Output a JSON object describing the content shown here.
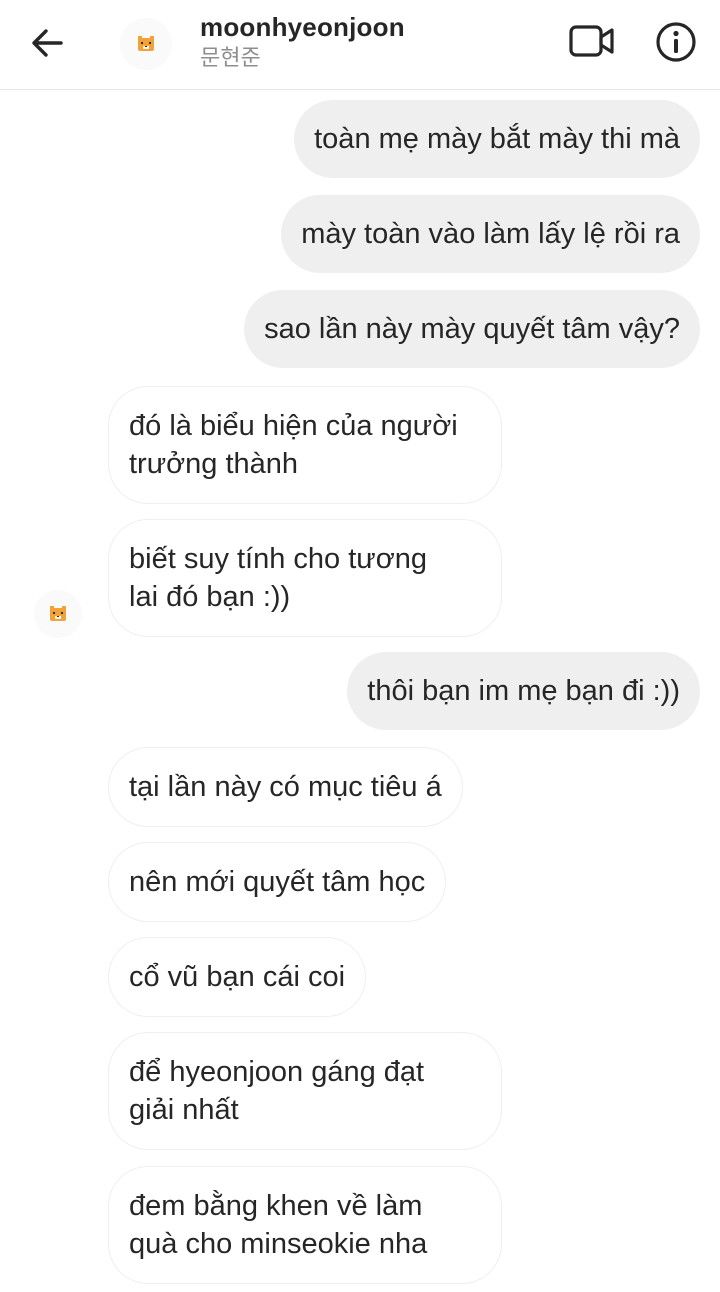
{
  "header": {
    "username": "moonhyeonjoon",
    "subname": "문현준",
    "back_icon": "arrow-left-icon",
    "video_icon": "video-camera-icon",
    "info_icon": "info-icon",
    "avatar_icon": "tiger-emoji-icon"
  },
  "messages": [
    {
      "side": "sent",
      "lines": [
        "toàn mẹ mày bắt mày thi mà"
      ]
    },
    {
      "side": "sent",
      "lines": [
        "mày toàn vào làm lấy lệ rồi ra"
      ]
    },
    {
      "side": "sent",
      "lines": [
        "sao lần này mày quyết tâm vậy?"
      ]
    },
    {
      "side": "received",
      "lines": [
        "đó là biểu hiện của người",
        "trưởng thành"
      ]
    },
    {
      "side": "received",
      "lines": [
        "biết suy tính cho tương",
        "lai đó bạn :))"
      ]
    },
    {
      "side": "sent",
      "lines": [
        "thôi bạn im mẹ bạn đi :))"
      ]
    },
    {
      "side": "received",
      "lines": [
        "tại lần này có mục tiêu á"
      ]
    },
    {
      "side": "received",
      "lines": [
        "nên mới quyết tâm học"
      ]
    },
    {
      "side": "received",
      "lines": [
        "cổ vũ bạn cái coi"
      ]
    },
    {
      "side": "received",
      "lines": [
        "để hyeonjoon gáng đạt",
        "giải nhất"
      ]
    },
    {
      "side": "received",
      "lines": [
        "đem bằng khen về làm",
        "quà cho minseokie nha"
      ]
    }
  ],
  "colors": {
    "sent_bubble": "#efefef",
    "received_border": "#efefef",
    "text": "#262626",
    "subtext": "#8e8e8e"
  }
}
